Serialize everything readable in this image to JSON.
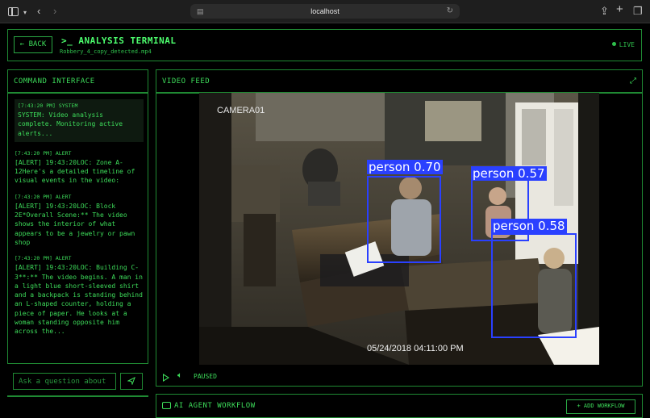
{
  "browser": {
    "url": "localhost"
  },
  "header": {
    "back_label": "← BACK",
    "title": ">_ ANALYSIS TERMINAL",
    "filename": "Robbery_4_copy_detected.mp4",
    "live_label": "LIVE"
  },
  "command_interface": {
    "title": "COMMAND INTERFACE",
    "messages": [
      {
        "timestamp": "[7:43:20 PM] SYSTEM",
        "text": "SYSTEM: Video analysis complete. Monitoring active alerts..."
      },
      {
        "timestamp": "[7:43:20 PM] ALERT",
        "text": "[ALERT] 19:43:20LOC: Zone A-12Here's a detailed timeline of visual events in the video:"
      },
      {
        "timestamp": "[7:43:20 PM] ALERT",
        "text": "[ALERT] 19:43:20LOC: Block 2E*Overall Scene:** The video shows the interior of what appears to be a jewelry or pawn shop"
      },
      {
        "timestamp": "[7:43:20 PM] ALERT",
        "text": "[ALERT] 19:43:20LOC: Building C-3**:** The video begins. A man in a light blue short-sleeved shirt and a backpack is standing behind an L-shaped counter, holding a piece of paper. He looks at a woman standing opposite him across the..."
      }
    ],
    "input_placeholder": "Ask a question about"
  },
  "video_feed": {
    "title": "VIDEO FEED",
    "camera_label": "CAMERA01",
    "timestamp": "05/24/2018 04:11:00 PM",
    "status": "PAUSED",
    "detections": [
      {
        "label": "person 0.70"
      },
      {
        "label": "person 0.57"
      },
      {
        "label": "person 0.58"
      }
    ],
    "box_color": "#2a40ff"
  },
  "workflow": {
    "title": "AI AGENT WORKFLOW",
    "button_label": "+ ADD WORKFLOW"
  },
  "colors": {
    "accent": "#3ddc5a",
    "border": "#1f8a33",
    "background": "#000000"
  }
}
